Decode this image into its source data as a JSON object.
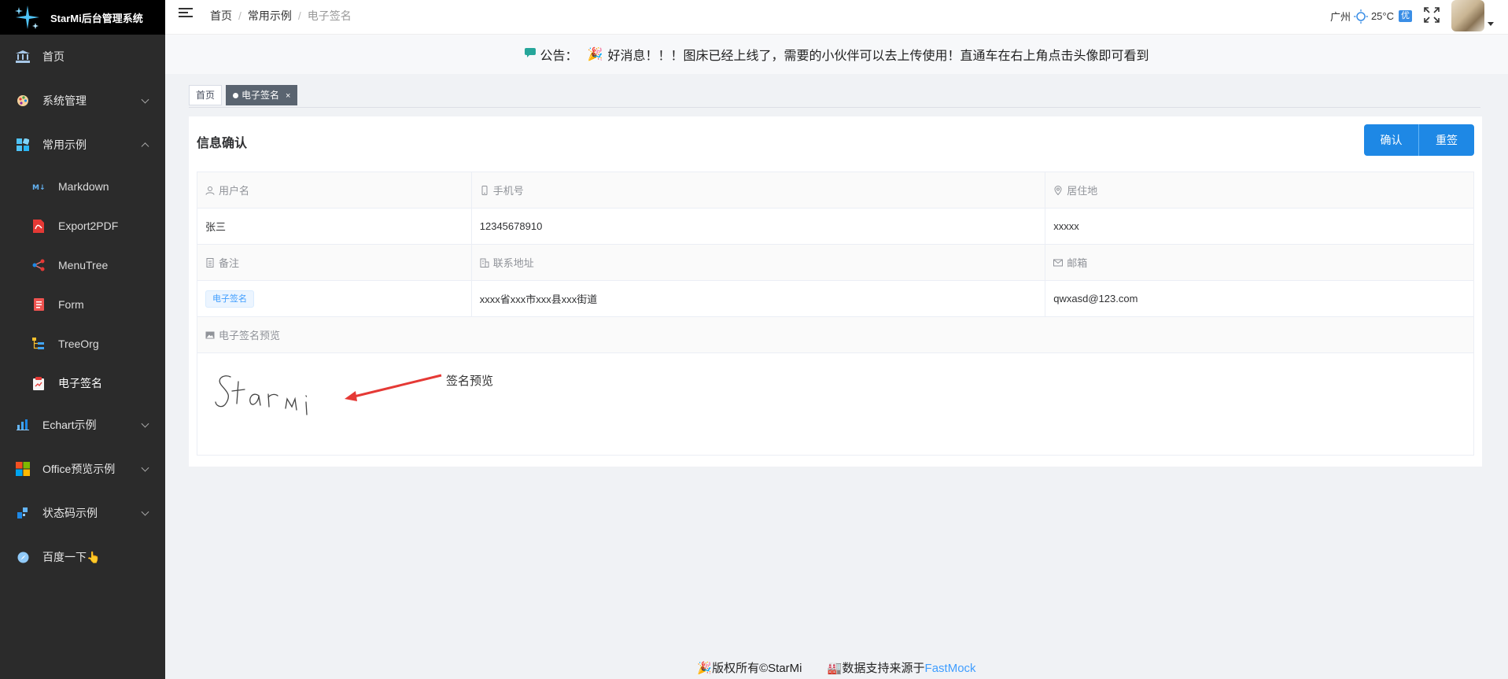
{
  "app": {
    "title": "StarMi后台管理系统"
  },
  "sidebar": {
    "items": [
      {
        "label": "首页",
        "icon": "bank-icon"
      },
      {
        "label": "系统管理",
        "icon": "palette-icon"
      },
      {
        "label": "常用示例",
        "icon": "blocks-icon"
      }
    ],
    "sub_items": [
      {
        "label": "Markdown",
        "icon": "markdown-icon"
      },
      {
        "label": "Export2PDF",
        "icon": "pdf-icon"
      },
      {
        "label": "MenuTree",
        "icon": "share-icon"
      },
      {
        "label": "Form",
        "icon": "form-icon"
      },
      {
        "label": "TreeOrg",
        "icon": "tree-icon"
      },
      {
        "label": "电子签名",
        "icon": "signature-icon"
      }
    ],
    "more_items": [
      {
        "label": "Echart示例",
        "icon": "bar-chart-icon"
      },
      {
        "label": "Office预览示例",
        "icon": "office-icon"
      },
      {
        "label": "状态码示例",
        "icon": "status-icon"
      },
      {
        "label": "百度一下👆",
        "icon": "compass-icon"
      }
    ]
  },
  "header": {
    "breadcrumb": [
      "首页",
      "常用示例",
      "电子签名"
    ],
    "city": "广州",
    "temperature": "25°C",
    "aqi": "优"
  },
  "notice": {
    "label": "公告：",
    "message": "好消息！！！图床已经上线了，需要的小伙伴可以去上传使用！直通车在右上角点击头像即可看到"
  },
  "tabs": [
    {
      "label": "首页",
      "active": false
    },
    {
      "label": "电子签名",
      "active": true
    }
  ],
  "card": {
    "title": "信息确认",
    "confirm_label": "确认",
    "resign_label": "重签",
    "fields": {
      "username_label": "用户名",
      "username": "张三",
      "phone_label": "手机号",
      "phone": "12345678910",
      "residence_label": "居住地",
      "residence": "xxxxx",
      "remark_label": "备注",
      "remark_tag": "电子签名",
      "address_label": "联系地址",
      "address": "xxxx省xxx市xxx县xxx街道",
      "email_label": "邮箱",
      "email": "qwxasd@123.com",
      "preview_label": "电子签名预览"
    },
    "signature_annotation": "签名预览"
  },
  "footer": {
    "copyright": "版权所有©StarMi",
    "data_source": "数据支持来源于",
    "link": "FastMock"
  },
  "colors": {
    "sidebar_bg": "#2b2b2b",
    "primary": "#1e88e5",
    "arrow": "#e53935"
  }
}
